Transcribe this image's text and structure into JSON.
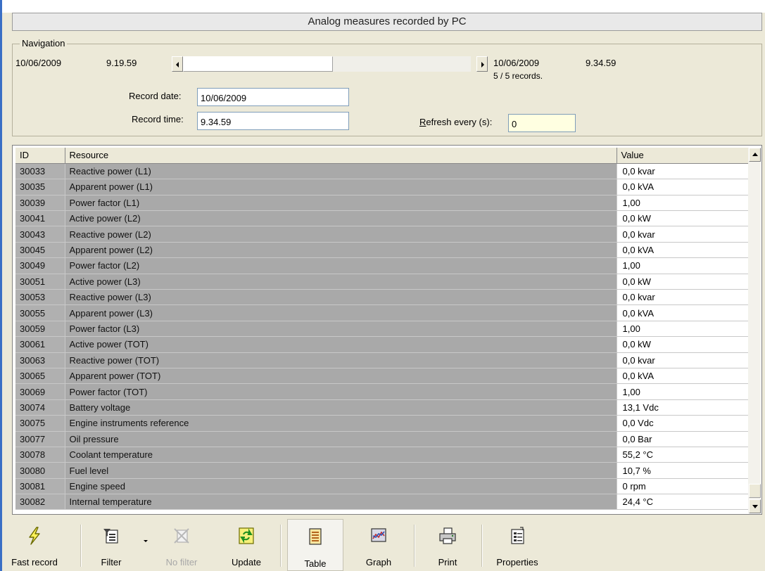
{
  "window": {
    "title": "Analog measures recorded by PC"
  },
  "navigation": {
    "legend": "Navigation",
    "start_date": "10/06/2009",
    "start_time": "9.19.59",
    "end_date": "10/06/2009",
    "end_time": "9.34.59",
    "records": "5 / 5 records.",
    "record_date_label": "Record date:",
    "record_date_value": "10/06/2009",
    "record_time_label": "Record time:",
    "record_time_value": "9.34.59",
    "refresh_label_mnemonic": "R",
    "refresh_label_rest": "efresh every (s):",
    "refresh_value": "0"
  },
  "table": {
    "headers": {
      "id": "ID",
      "resource": "Resource",
      "value": "Value"
    },
    "rows": [
      {
        "id": "30033",
        "resource": "Reactive power (L1)",
        "value": "0,0 kvar"
      },
      {
        "id": "30035",
        "resource": "Apparent power (L1)",
        "value": "0,0 kVA"
      },
      {
        "id": "30039",
        "resource": "Power factor (L1)",
        "value": "1,00"
      },
      {
        "id": "30041",
        "resource": "Active power (L2)",
        "value": "0,0 kW"
      },
      {
        "id": "30043",
        "resource": "Reactive power (L2)",
        "value": "0,0 kvar"
      },
      {
        "id": "30045",
        "resource": "Apparent power (L2)",
        "value": "0,0 kVA"
      },
      {
        "id": "30049",
        "resource": "Power factor (L2)",
        "value": "1,00"
      },
      {
        "id": "30051",
        "resource": "Active power (L3)",
        "value": "0,0 kW"
      },
      {
        "id": "30053",
        "resource": "Reactive power (L3)",
        "value": "0,0 kvar"
      },
      {
        "id": "30055",
        "resource": "Apparent power (L3)",
        "value": "0,0 kVA"
      },
      {
        "id": "30059",
        "resource": "Power factor (L3)",
        "value": "1,00"
      },
      {
        "id": "30061",
        "resource": "Active power (TOT)",
        "value": "0,0 kW"
      },
      {
        "id": "30063",
        "resource": "Reactive power (TOT)",
        "value": "0,0 kvar"
      },
      {
        "id": "30065",
        "resource": "Apparent power (TOT)",
        "value": "0,0 kVA"
      },
      {
        "id": "30069",
        "resource": "Power factor (TOT)",
        "value": "1,00"
      },
      {
        "id": "30074",
        "resource": "Battery voltage",
        "value": "13,1 Vdc"
      },
      {
        "id": "30075",
        "resource": "Engine instruments reference",
        "value": "0,0 Vdc"
      },
      {
        "id": "30077",
        "resource": "Oil pressure",
        "value": "0,0 Bar"
      },
      {
        "id": "30078",
        "resource": "Coolant temperature",
        "value": "55,2 °C"
      },
      {
        "id": "30080",
        "resource": "Fuel level",
        "value": "10,7 %"
      },
      {
        "id": "30081",
        "resource": "Engine speed",
        "value": "0 rpm"
      },
      {
        "id": "30082",
        "resource": "Internal temperature",
        "value": "24,4 °C"
      }
    ]
  },
  "toolbar": {
    "fast_record": "Fast record",
    "filter": "Filter",
    "no_filter": "No filter",
    "update": "Update",
    "table": "Table",
    "graph": "Graph",
    "print": "Print",
    "properties": "Properties"
  },
  "icons": {
    "fast_record": "lightning-icon",
    "filter": "filter-icon",
    "no_filter": "no-filter-icon",
    "update": "refresh-icon",
    "table": "table-icon",
    "graph": "graph-icon",
    "print": "printer-icon",
    "properties": "properties-icon"
  },
  "colors": {
    "accent": "#3a6fc5",
    "window_bg": "#ece9d8",
    "readonly_cell": "#a9a9a9",
    "refresh_field": "#ffffe1"
  }
}
